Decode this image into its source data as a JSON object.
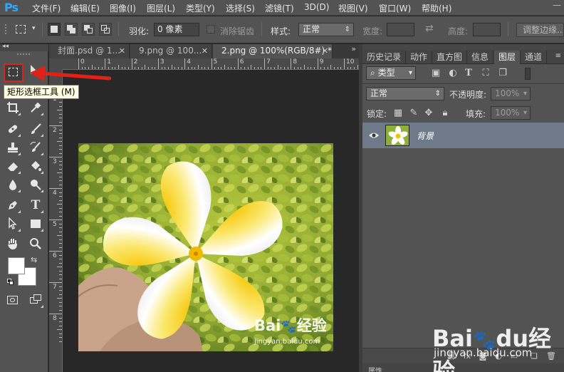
{
  "app": {
    "logo": "Ps"
  },
  "menubar": {
    "items": [
      "文件(F)",
      "编辑(E)",
      "图像(I)",
      "图层(L)",
      "类型(Y)",
      "选择(S)",
      "滤镜(T)",
      "3D(D)",
      "视图(V)",
      "窗口(W)",
      "帮助(H)"
    ]
  },
  "options": {
    "feather_label": "羽化:",
    "feather_value": "0 像素",
    "antialias_label": "消除锯齿",
    "style_label": "样式:",
    "style_value": "正常",
    "width_label": "宽度:",
    "height_label": "高度:",
    "refine_edge_label": "调整边缘..."
  },
  "toolbox": {
    "tooltip": "矩形选框工具 (M)",
    "fg_color": "#ffffff",
    "bg_color": "#ffffff"
  },
  "documents": {
    "tabs": [
      {
        "label": "封面.psd @ 1..."
      },
      {
        "label": "9.png @ 100..."
      },
      {
        "label": "2.png @ 100%(RGB/8#) *"
      }
    ]
  },
  "rulers": {
    "top_labels": [
      "0",
      "1",
      "2",
      "3",
      "4",
      "5",
      "6",
      "7",
      "8",
      "9",
      "10"
    ],
    "left_labels": [
      "1",
      "2",
      "3",
      "4",
      "5",
      "6",
      "7",
      "8"
    ]
  },
  "panel": {
    "tabs": [
      "历史记录",
      "动作",
      "直方图",
      "信息",
      "图层",
      "通道"
    ],
    "active_tab": "图层",
    "filter_kind": "类型",
    "blend_mode": "正常",
    "opacity_label": "不透明度:",
    "opacity_value": "100%",
    "lock_label": "锁定:",
    "fill_label": "填充:",
    "fill_value": "100%",
    "layers": [
      {
        "name": "背景"
      }
    ],
    "bottom_tab": "属性"
  },
  "watermark": {
    "brand_left": "Bai",
    "brand_right": "经验",
    "brand_du": "du",
    "url": "jingyan.baidu.com"
  },
  "colors": {
    "selection_highlight": "#d8251e",
    "layer_selected": "#6e7a8a",
    "ps_blue": "#31a8ff"
  }
}
